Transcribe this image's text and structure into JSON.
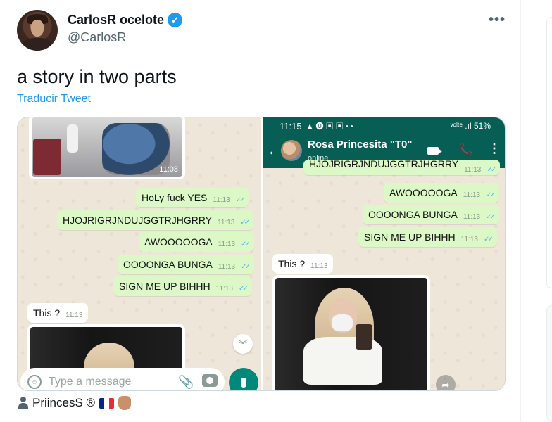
{
  "author": {
    "display_name": "CarlosR ocelote",
    "verified_badge": "✓",
    "handle": "@CarlosR"
  },
  "more_menu": "•••",
  "tweet": {
    "text": "a story in two parts",
    "translate_label": "Traducir Tweet"
  },
  "left_chat": {
    "photo_time": "11:08",
    "messages": [
      {
        "text": "HoLy fuck YES",
        "time": "11:13",
        "ticks": "✓✓"
      },
      {
        "text": "HJOJRIGRJNDUJGGTRJHGRRY",
        "time": "11:13",
        "ticks": "✓✓"
      },
      {
        "text": "AWOOOOOGA",
        "time": "11:13",
        "ticks": "✓✓"
      },
      {
        "text": "OOOONGA BUNGA",
        "time": "11:13",
        "ticks": "✓✓"
      },
      {
        "text": "SIGN ME UP BIHHH",
        "time": "11:13",
        "ticks": "✓✓"
      }
    ],
    "incoming": {
      "text": "This ?",
      "time": "11:13"
    },
    "scroll_glyph": "︾",
    "input_placeholder": "Type a message",
    "clip_glyph": "📎"
  },
  "right_chat": {
    "status_time": "11:15",
    "status_icons": "▲ 🅤 ▣ ▣ ▪ •",
    "battery": "ᵛᵒˡᵗᵉ .ıl 51%",
    "back_glyph": "←",
    "contact_name": "Rosa Princesita \"T0\"",
    "contact_status": "online",
    "call_glyph": "📞",
    "menu_glyph": "⋮",
    "messages": [
      {
        "text": "HJOJRIGRJNDUJGGTRJHGRRY",
        "time": "11:13",
        "ticks": "✓✓"
      },
      {
        "text": "AWOOOOOGA",
        "time": "11:13",
        "ticks": "✓✓"
      },
      {
        "text": "OOOONGA BUNGA",
        "time": "11:13",
        "ticks": "✓✓"
      },
      {
        "text": "SIGN ME UP BIHHH",
        "time": "11:13",
        "ticks": "✓✓"
      }
    ],
    "incoming": {
      "text": "This ?",
      "time": "11:13"
    },
    "forward_glyph": "➦"
  },
  "reply_line": {
    "name": "PriincesS ®",
    "flag_colors": [
      "#002395",
      "#ffffff",
      "#ed2939"
    ]
  },
  "colors": {
    "link": "#1d9bf0",
    "whatsapp_header": "#075e54",
    "outgoing_bubble": "#dcf8c6",
    "mic_button": "#00897b"
  }
}
